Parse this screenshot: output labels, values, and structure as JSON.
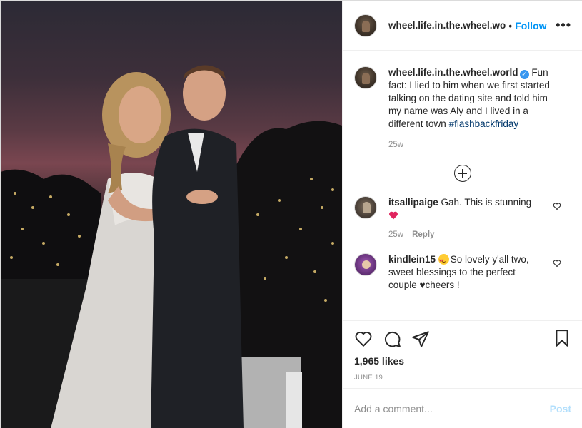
{
  "photo": {
    "alt_icon": "wedding-couple-photo"
  },
  "header": {
    "username": "wheel.life.in.the.wheel.wo",
    "separator": "•",
    "follow_label": "Follow",
    "more_icon": "more-options-icon",
    "more_label": "•••"
  },
  "caption": {
    "username": "wheel.life.in.the.wheel.world",
    "verified_mark": "✓",
    "text": "Fun fact: I lied to him when we first started talking on the dating site and told him my name was Aly and I lived in a different town",
    "hashtag": "#flashbackfriday",
    "time": "25w"
  },
  "load_more_icon": "plus-circle-icon",
  "comments": [
    {
      "username": "itsallipaige",
      "text": "Gah. This is stunning",
      "emoji": "red-heart",
      "time": "25w",
      "reply_label": "Reply"
    },
    {
      "username": "kindlein15",
      "emoji": "heart-eyes-face",
      "text": "So lovely y'all two, sweet blessings to the perfect couple ♥cheers !"
    }
  ],
  "actions": {
    "like_icon": "heart-icon",
    "comment_icon": "comment-icon",
    "share_icon": "send-icon",
    "save_icon": "bookmark-icon"
  },
  "likes": "1,965 likes",
  "date": "JUNE 19",
  "add_comment": {
    "placeholder": "Add a comment...",
    "post_label": "Post"
  },
  "colors": {
    "link_blue": "#0095f6",
    "hashtag": "#00376b",
    "secondary_text": "#8e8e8e",
    "post_disabled": "#b2dffc"
  }
}
